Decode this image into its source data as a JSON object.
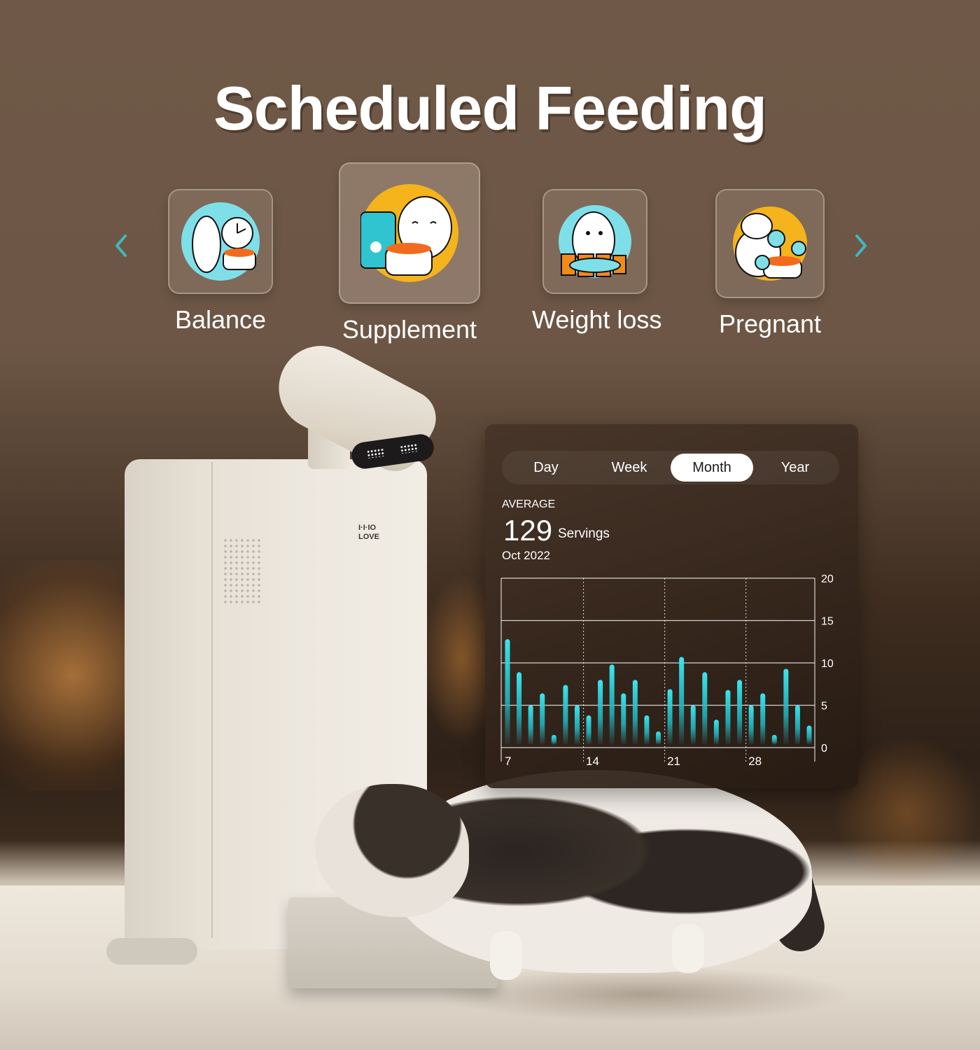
{
  "title": "Scheduled Feeding",
  "carousel": {
    "prev_icon": "chevron-left-icon",
    "next_icon": "chevron-right-icon",
    "accent_color": "#3fb8bf",
    "modes": [
      {
        "label": "Balance",
        "icon": "cat-with-clock-and-bowl-icon",
        "circle_color": "#7fdfe8",
        "selected": false
      },
      {
        "label": "Supplement",
        "icon": "cat-with-food-bag-icon",
        "circle_color": "#f5b31c",
        "selected": true
      },
      {
        "label": "Weight loss",
        "icon": "cat-with-fish-icon",
        "circle_color": "#7fdfe8",
        "selected": false
      },
      {
        "label": "Pregnant",
        "icon": "pregnant-cat-with-fish-bubbles-icon",
        "circle_color": "#f5b31c",
        "selected": false
      }
    ]
  },
  "product": {
    "brand_line1": "I·I·IO",
    "brand_line2": "LOVE"
  },
  "panel": {
    "tabs": [
      "Day",
      "Week",
      "Month",
      "Year"
    ],
    "active_tab": "Month",
    "average_label": "AVERAGE",
    "average_value": "129",
    "average_unit": "Servings",
    "period": "Oct 2022"
  },
  "chart_data": {
    "type": "bar",
    "title": "",
    "xlabel": "",
    "ylabel": "",
    "x_ticks": [
      "7",
      "14",
      "21",
      "28"
    ],
    "y_ticks": [
      0,
      5,
      10,
      15,
      20
    ],
    "ylim": [
      0,
      20
    ],
    "grid": true,
    "y_axis_side": "right",
    "bar_color": "#2fd6e0",
    "values": [
      12.8,
      8.9,
      5,
      6.4,
      1.5,
      7.4,
      5,
      3.8,
      8,
      9.8,
      6.4,
      8,
      3.8,
      1.9,
      6.9,
      10.7,
      5,
      8.9,
      3.3,
      6.8,
      8,
      5,
      6.4,
      1.5,
      9.3,
      5,
      2.6
    ]
  }
}
